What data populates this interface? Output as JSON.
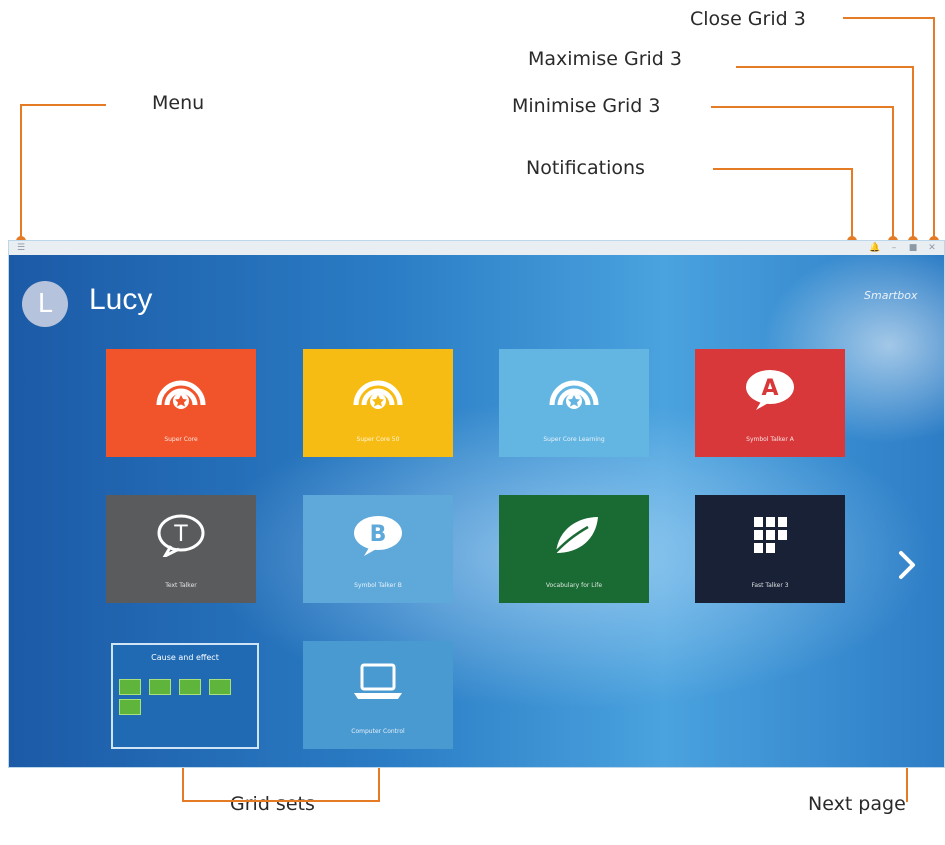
{
  "callouts": {
    "close": "Close Grid 3",
    "maximise": "Maximise Grid 3",
    "minimise": "Minimise Grid 3",
    "notifications": "Notifications",
    "menu": "Menu",
    "grid_sets": "Grid sets",
    "next_page": "Next page"
  },
  "window": {
    "titlebar": {
      "menu_icon": "menu-icon",
      "notifications_icon": "bell-icon",
      "minimise_icon": "minimise-icon",
      "maximise_icon": "maximise-icon",
      "close_icon": "close-icon"
    }
  },
  "user": {
    "initial": "L",
    "name": "Lucy"
  },
  "brand": "Smartbox",
  "colors": {
    "callout_orange": "#e57c25",
    "tile_red_orange": "#f1542a",
    "tile_yellow": "#f7bc13",
    "tile_light_blue": "#63b5e2",
    "tile_red": "#d8383a",
    "tile_gray": "#5a5b5d",
    "tile_blue": "#5fa9da",
    "tile_green": "#1a6a34",
    "tile_navy": "#182136"
  },
  "grid_sets": [
    {
      "label": "Super Core",
      "color": "#f1542a",
      "icon": "broadcast-star-icon"
    },
    {
      "label": "Super Core 50",
      "color": "#f7bc13",
      "icon": "broadcast-star-icon"
    },
    {
      "label": "Super Core Learning",
      "color": "#63b5e2",
      "icon": "broadcast-star-icon"
    },
    {
      "label": "Symbol Talker A",
      "color": "#d8383a",
      "icon": "speech-a-icon"
    },
    {
      "label": "Text Talker",
      "color": "#5a5b5d",
      "icon": "speech-t-icon"
    },
    {
      "label": "Symbol Talker B",
      "color": "#5fa9da",
      "icon": "speech-b-icon"
    },
    {
      "label": "Vocabulary for Life",
      "color": "#1a6a34",
      "icon": "leaf-icon"
    },
    {
      "label": "Fast Talker 3",
      "color": "#182136",
      "icon": "windows-icon"
    },
    {
      "label": "Cause and effect",
      "color": "#1f6ab3",
      "icon": "thumbnails"
    },
    {
      "label": "Computer Control",
      "color": "#4a9ad2",
      "icon": "laptop-icon"
    }
  ],
  "next_page_icon": "chevron-right-icon"
}
